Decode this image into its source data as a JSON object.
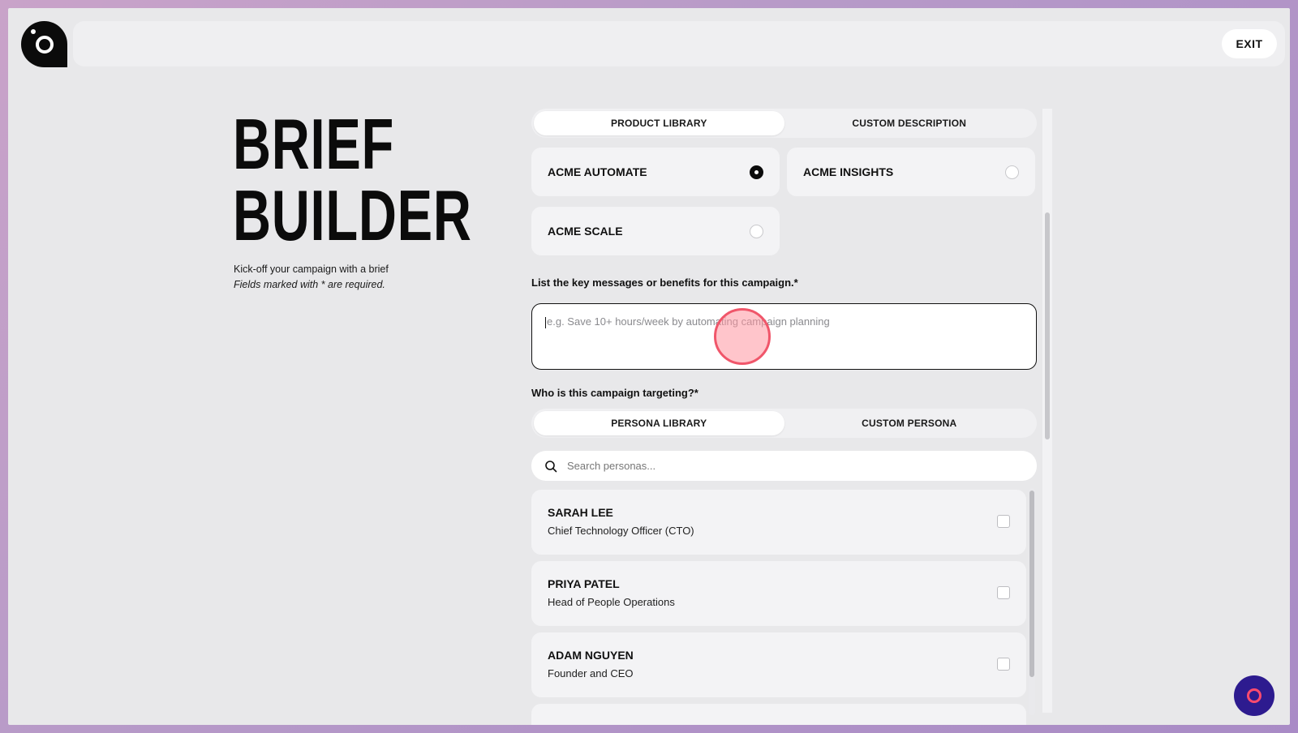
{
  "header": {
    "exit_label": "EXIT"
  },
  "title": {
    "line1": "BRIEF",
    "line2": "BUILDER"
  },
  "intro": {
    "subtitle": "Kick-off your campaign with a brief",
    "required_note": "Fields marked with * are required."
  },
  "product_source_tabs": [
    {
      "label": "PRODUCT LIBRARY",
      "active": true
    },
    {
      "label": "CUSTOM DESCRIPTION",
      "active": false
    }
  ],
  "products": [
    {
      "name": "ACME AUTOMATE",
      "selected": true
    },
    {
      "name": "ACME INSIGHTS",
      "selected": false
    },
    {
      "name": "ACME SCALE",
      "selected": false
    }
  ],
  "key_messages": {
    "label": "List the key messages or benefits for this campaign.*",
    "placeholder": "e.g. Save 10+ hours/week by automating campaign planning",
    "value": ""
  },
  "targeting": {
    "label": "Who is this campaign targeting?*",
    "tabs": [
      {
        "label": "PERSONA LIBRARY",
        "active": true
      },
      {
        "label": "CUSTOM PERSONA",
        "active": false
      }
    ],
    "search_placeholder": "Search personas...",
    "personas": [
      {
        "name": "SARAH LEE",
        "role": "Chief Technology Officer (CTO)",
        "checked": false
      },
      {
        "name": "PRIYA PATEL",
        "role": "Head of People Operations",
        "checked": false
      },
      {
        "name": "ADAM NGUYEN",
        "role": "Founder and CEO",
        "checked": false
      }
    ]
  },
  "colors": {
    "background": "#e8e8ea",
    "accent_dark": "#0b0b0b",
    "fab_background": "#2d1b8f",
    "fab_accent": "#ff4b6e",
    "click_marker": "#f0566a"
  },
  "icons": {
    "logo": "logo-icon",
    "search": "search-icon",
    "assistant": "assistant-icon"
  }
}
